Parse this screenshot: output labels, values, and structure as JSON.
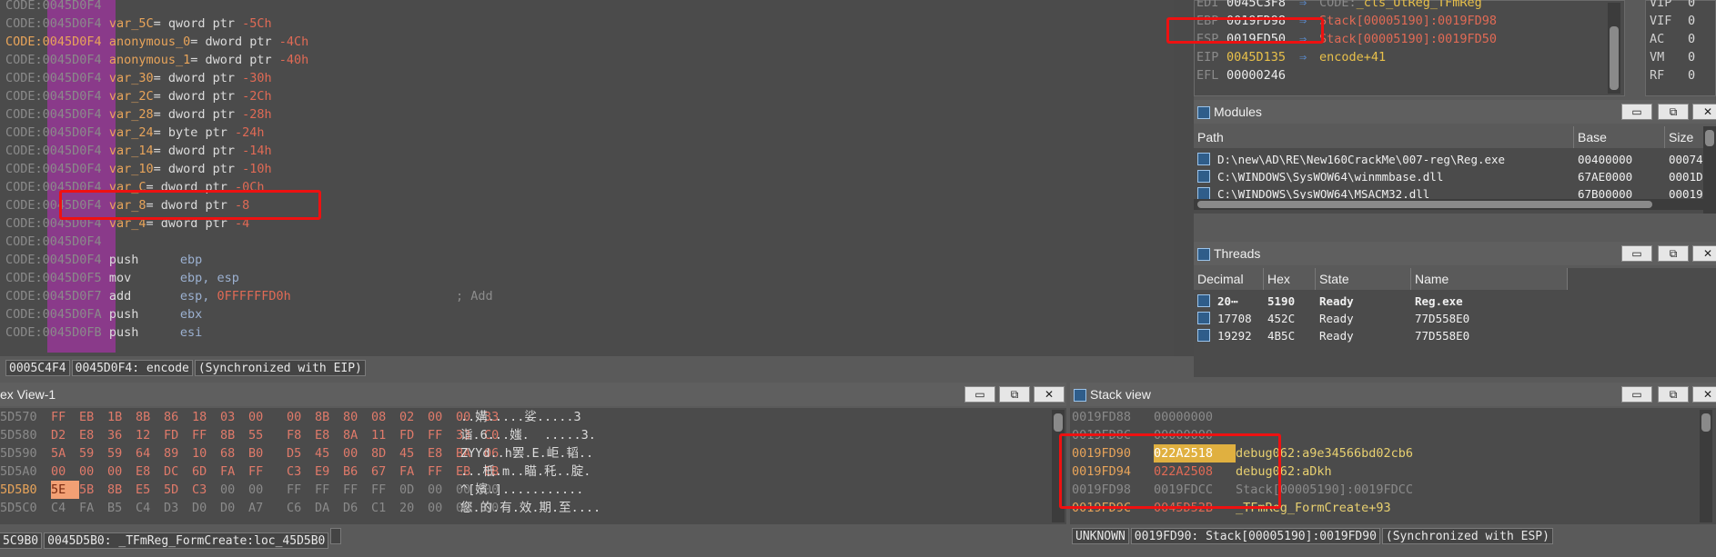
{
  "disasm": {
    "lines": [
      {
        "seg": "CODE:",
        "addr": "0045D0F4",
        "text": "",
        "seg_hl": false
      },
      {
        "seg": "CODE:",
        "addr": "0045D0F4",
        "name": "var_5C",
        "rest": "= qword ptr ",
        "num": "-5Ch"
      },
      {
        "seg": "CODE:",
        "addr": "0045D0F4",
        "name": "anonymous_0",
        "rest": "= dword ptr ",
        "num": "-4Ch",
        "seg_hl": true
      },
      {
        "seg": "CODE:",
        "addr": "0045D0F4",
        "name": "anonymous_1",
        "rest": "= dword ptr ",
        "num": "-40h"
      },
      {
        "seg": "CODE:",
        "addr": "0045D0F4",
        "name": "var_30",
        "rest": "= dword ptr ",
        "num": "-30h"
      },
      {
        "seg": "CODE:",
        "addr": "0045D0F4",
        "name": "var_2C",
        "rest": "= dword ptr ",
        "num": "-2Ch"
      },
      {
        "seg": "CODE:",
        "addr": "0045D0F4",
        "name": "var_28",
        "rest": "= dword ptr ",
        "num": "-28h"
      },
      {
        "seg": "CODE:",
        "addr": "0045D0F4",
        "name": "var_24",
        "rest": "= byte ptr ",
        "num": "-24h"
      },
      {
        "seg": "CODE:",
        "addr": "0045D0F4",
        "name": "var_14",
        "rest": "= dword ptr ",
        "num": "-14h"
      },
      {
        "seg": "CODE:",
        "addr": "0045D0F4",
        "name": "var_10",
        "rest": "= dword ptr ",
        "num": "-10h"
      },
      {
        "seg": "CODE:",
        "addr": "0045D0F4",
        "name": "var_C",
        "rest": "= dword ptr ",
        "num": "-0Ch"
      },
      {
        "seg": "CODE:",
        "addr": "0045D0F4",
        "name": "var_8",
        "rest": "= dword ptr ",
        "num": "-8"
      },
      {
        "seg": "CODE:",
        "addr": "0045D0F4",
        "name": "var_4",
        "rest": "= dword ptr ",
        "num": "-4"
      },
      {
        "seg": "CODE:",
        "addr": "0045D0F4",
        "name": "",
        "rest": "",
        "num": ""
      },
      {
        "seg": "CODE:",
        "addr": "0045D0F4",
        "mnem": "push",
        "ops": "ebp",
        "ops2": "",
        "comment": ""
      },
      {
        "seg": "CODE:",
        "addr": "0045D0F5",
        "mnem": "mov",
        "ops": "ebp, esp",
        "ops2": "",
        "comment": ""
      },
      {
        "seg": "CODE:",
        "addr": "0045D0F7",
        "mnem": "add",
        "ops": "esp, ",
        "ops2": "0FFFFFFD0h",
        "comment": "; Add"
      },
      {
        "seg": "CODE:",
        "addr": "0045D0FA",
        "mnem": "push",
        "ops": "ebx",
        "ops2": "",
        "comment": ""
      },
      {
        "seg": "CODE:",
        "addr": "0045D0FB",
        "mnem": "push",
        "ops": "esi",
        "ops2": "",
        "comment": ""
      }
    ],
    "status": [
      "0005C4F4",
      "0045D0F4: encode",
      "(Synchronized with EIP)"
    ]
  },
  "registers": [
    {
      "name": "EDI",
      "value": "0045C3F8",
      "arrow": "⇒",
      "seg": "CODE:",
      "target": "_cls_UtReg_TFmReg"
    },
    {
      "name": "EBP",
      "value": "0019FD98",
      "arrow": "⇒",
      "seg": "",
      "target": "Stack[00005190]:0019FD98"
    },
    {
      "name": "ESP",
      "value": "0019FD50",
      "arrow": "⇒",
      "seg": "",
      "target": "Stack[00005190]:0019FD50"
    },
    {
      "name": "EIP",
      "value": "0045D135",
      "arrow": "⇒",
      "seg": "",
      "target": "encode+41"
    },
    {
      "name": "EFL",
      "value": "00000246",
      "arrow": "",
      "seg": "",
      "target": ""
    }
  ],
  "flags": [
    {
      "name": "VIP",
      "value": "0"
    },
    {
      "name": "VIF",
      "value": "0"
    },
    {
      "name": "AC",
      "value": "0"
    },
    {
      "name": "VM",
      "value": "0"
    },
    {
      "name": "RF",
      "value": "0"
    }
  ],
  "modules": {
    "title": "Modules",
    "columns": [
      "Path",
      "Base",
      "Size"
    ],
    "rows": [
      {
        "path": "D:\\new\\AD\\RE\\New160CrackMe\\007-reg\\Reg.exe",
        "base": "00400000",
        "size": "00074"
      },
      {
        "path": "C:\\WINDOWS\\SysWOW64\\winmmbase.dll",
        "base": "67AE0000",
        "size": "0001D"
      },
      {
        "path": "C:\\WINDOWS\\SysWOW64\\MSACM32.dll",
        "base": "67B00000",
        "size": "00019"
      }
    ]
  },
  "threads": {
    "title": "Threads",
    "columns": [
      "Decimal",
      "Hex",
      "State",
      "Name"
    ],
    "rows": [
      {
        "dec": "20⋯",
        "hex": "5190",
        "state": "Ready",
        "name": "Reg.exe",
        "bold": true
      },
      {
        "dec": "17708",
        "hex": "452C",
        "state": "Ready",
        "name": "77D558E0",
        "bold": false
      },
      {
        "dec": "19292",
        "hex": "4B5C",
        "state": "Ready",
        "name": "77D558E0",
        "bold": false
      }
    ]
  },
  "hexview": {
    "title": "ex View-1",
    "rows": [
      {
        "addr": "5D570",
        "bytes": [
          "FF",
          "EB",
          "1B",
          "8B",
          "86",
          "18",
          "03",
          "00",
          "00",
          "8B",
          "80",
          "08",
          "02",
          "00",
          "00",
          "33"
        ],
        "ascii": "..媾.....娑.....3"
      },
      {
        "addr": "5D580",
        "bytes": [
          "D2",
          "E8",
          "36",
          "12",
          "FD",
          "FF",
          "8B",
          "55",
          "F8",
          "E8",
          "8A",
          "11",
          "FD",
          "FF",
          "33",
          "C0"
        ],
        "ascii": "诣.6...媸.  .....3."
      },
      {
        "addr": "5D590",
        "bytes": [
          "5A",
          "59",
          "59",
          "64",
          "89",
          "10",
          "68",
          "B0",
          "D5",
          "45",
          "00",
          "8D",
          "45",
          "E8",
          "BA",
          "06"
        ],
        "ascii": "ZYYd..h罢.E.岠.韬.."
      },
      {
        "addr": "5D5A0",
        "bytes": [
          "00",
          "00",
          "00",
          "E8",
          "DC",
          "6D",
          "FA",
          "FF",
          "C3",
          "E9",
          "B6",
          "67",
          "FA",
          "FF",
          "EB",
          "EB"
        ],
        "ascii": "...柢.m..瞄.秅..腚."
      },
      {
        "addr": "5D5B0",
        "bytes": [
          "5E",
          "5B",
          "8B",
          "E5",
          "5D",
          "C3",
          "00",
          "00",
          "FF",
          "FF",
          "FF",
          "FF",
          "0D",
          "00",
          "00",
          "00"
        ],
        "ascii": "^[嬪.]..........."
      },
      {
        "addr": "5D5C0",
        "bytes": [
          "C4",
          "FA",
          "B5",
          "C4",
          "D3",
          "D0",
          "D0",
          "A7",
          "C6",
          "DA",
          "D6",
          "C1",
          "20",
          "00",
          "00",
          "00"
        ],
        "ascii": "您.的.有.效.期.至...."
      }
    ],
    "status": [
      "5C9B0",
      "0045D5B0: _TFmReg_FormCreate:loc_45D5B0"
    ]
  },
  "stackview": {
    "title": "Stack view",
    "rows": [
      {
        "addr": "0019FD88",
        "value": "00000000",
        "comment": "",
        "dim": true
      },
      {
        "addr": "0019FD8C",
        "value": "00000000",
        "comment": "",
        "dim": true
      },
      {
        "addr": "0019FD90",
        "value": "022A2518",
        "comment": "debug062:a9e34566bd02cb6",
        "dim": false,
        "sel": true
      },
      {
        "addr": "0019FD94",
        "value": "022A2508",
        "comment": "debug062:aDkh",
        "dim": false
      },
      {
        "addr": "0019FD98",
        "value": "0019FDCC",
        "comment": "Stack[00005190]:0019FDCC",
        "dim": true
      },
      {
        "addr": "0019FD9C",
        "value": "0045D52B",
        "comment": "_TFmReg_FormCreate+93",
        "dim": false
      }
    ],
    "status": [
      "UNKNOWN",
      "0019FD90: Stack[00005190]:0019FD90",
      "(Synchronized with ESP)"
    ]
  },
  "window_buttons": {
    "restore": "▭",
    "float": "⧉",
    "close": "✕"
  }
}
